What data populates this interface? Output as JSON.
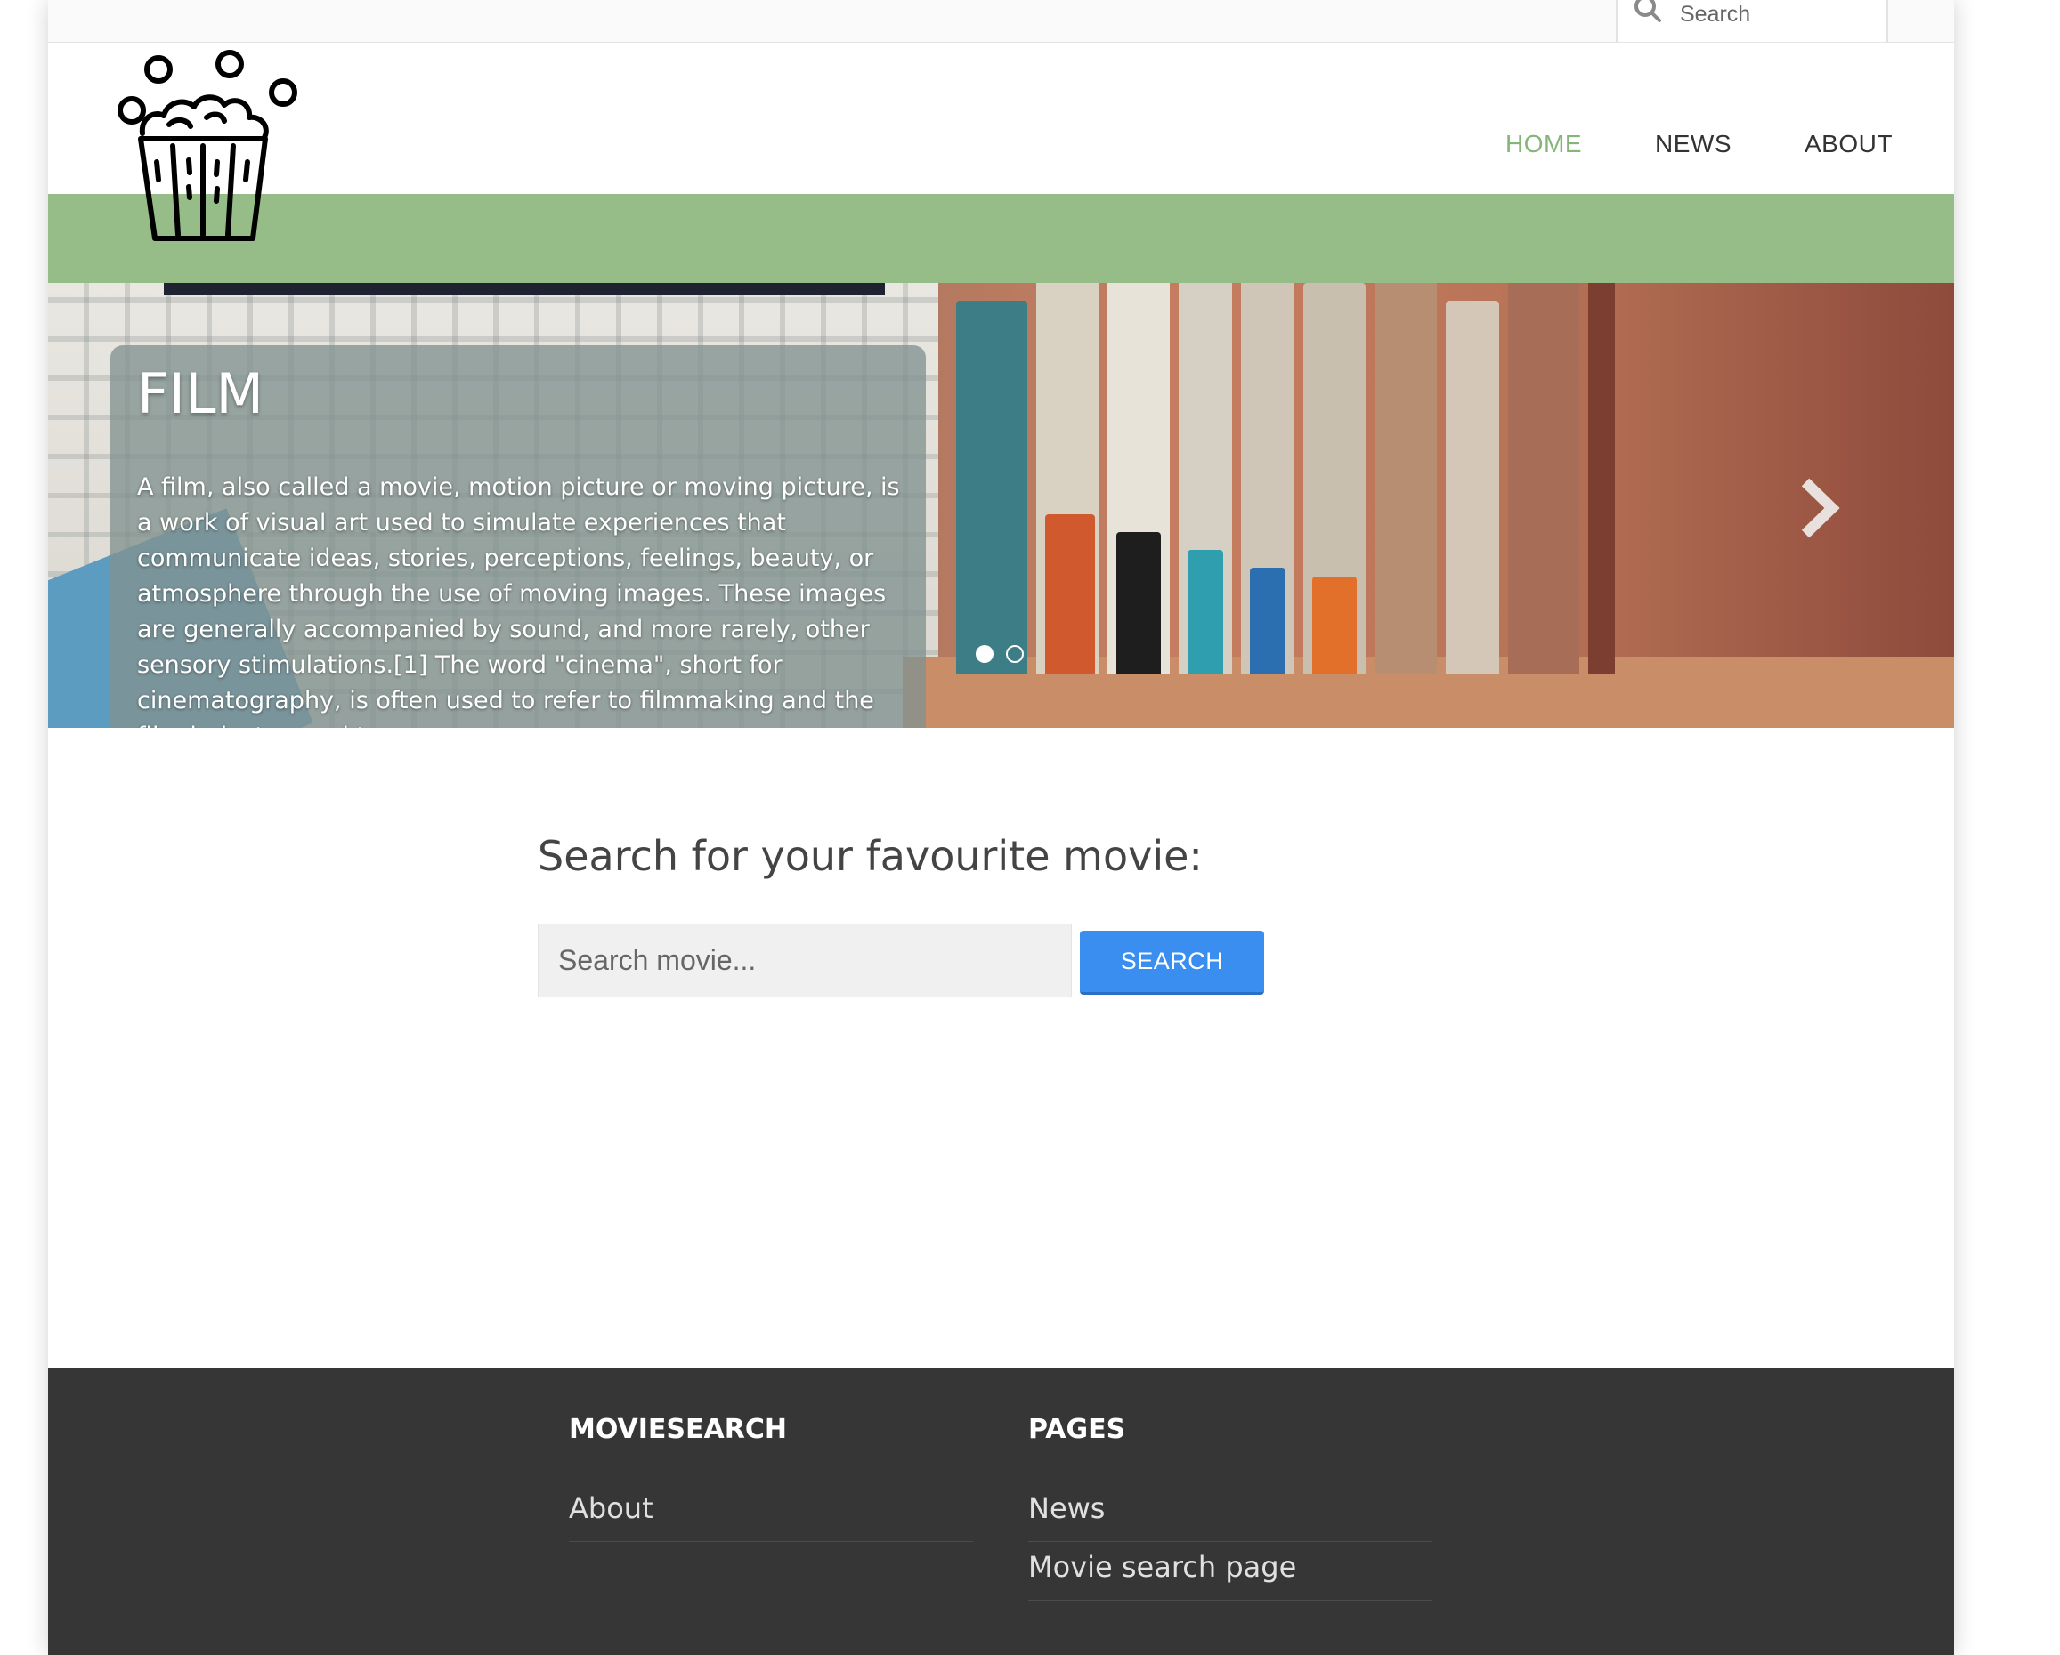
{
  "top_search": {
    "label": "Search",
    "icon": "search-icon"
  },
  "nav": {
    "home": "HOME",
    "news": "NEWS",
    "about": "ABOUT"
  },
  "colors": {
    "accent_green": "#96bd88",
    "nav_active": "#86b57a",
    "button_blue": "#3a8eef",
    "footer_bg": "#363636"
  },
  "hero": {
    "title": "FILM",
    "text": "A film, also called a movie, motion picture or moving picture, is a work of visual art used to simulate experiences that communicate ideas, stories, perceptions, feelings, beauty, or atmosphere through the use of moving images. These images are generally accompanied by sound, and more rarely, other sensory stimulations.[1] The word \"cinema\", short for cinematography, is often used to refer to filmmaking and the film industry, and to",
    "slides": 2,
    "active_slide": 1
  },
  "search": {
    "title": "Search for your favourite movie:",
    "placeholder": "Search movie...",
    "button": "SEARCH"
  },
  "footer": {
    "col1": {
      "title": "MOVIESEARCH",
      "links": [
        "About"
      ]
    },
    "col2": {
      "title": "PAGES",
      "links": [
        "News",
        "Movie search page"
      ]
    }
  }
}
